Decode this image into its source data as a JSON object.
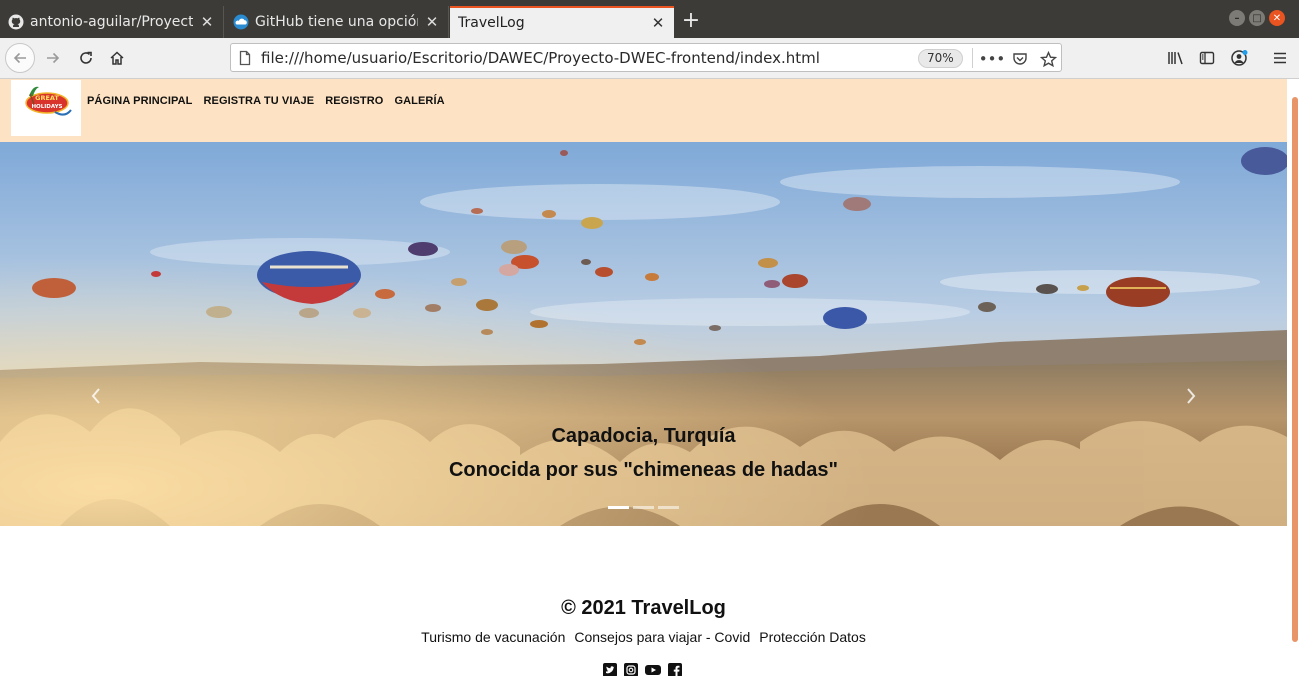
{
  "browser": {
    "tabs": [
      {
        "label": "antonio-aguilar/Proyecto",
        "icon": "github-icon",
        "active": false
      },
      {
        "label": "GitHub tiene una opción",
        "icon": "cloud-icon",
        "active": false
      },
      {
        "label": "TravelLog",
        "icon": "",
        "active": true
      }
    ],
    "new_tab_label": "+",
    "url": "file:///home/usuario/Escritorio/DAWEC/Proyecto-DWEC-frontend/index.html",
    "zoom": "70%",
    "accent_color": "#e95420"
  },
  "site": {
    "logo_text_top": "GREAT",
    "logo_text_bottom": "HOLIDAYS",
    "menu": [
      "PÁGINA PRINCIPAL",
      "REGISTRA TU VIAJE",
      "REGISTRO",
      "GALERÍA"
    ],
    "header_color": "#fde3c3",
    "carousel": {
      "caption_title": "Capadocia, Turquía",
      "caption_text": "Conocida por sus \"chimeneas de hadas\"",
      "active_slide": 1,
      "slide_count": 3
    },
    "footer": {
      "title": "© 2021 TravelLog",
      "links": [
        "Turismo de vacunación",
        "Consejos para viajar - Covid",
        "Protección Datos"
      ],
      "social_icons": [
        "twitter-icon",
        "instagram-icon",
        "youtube-icon",
        "facebook-icon"
      ]
    }
  }
}
